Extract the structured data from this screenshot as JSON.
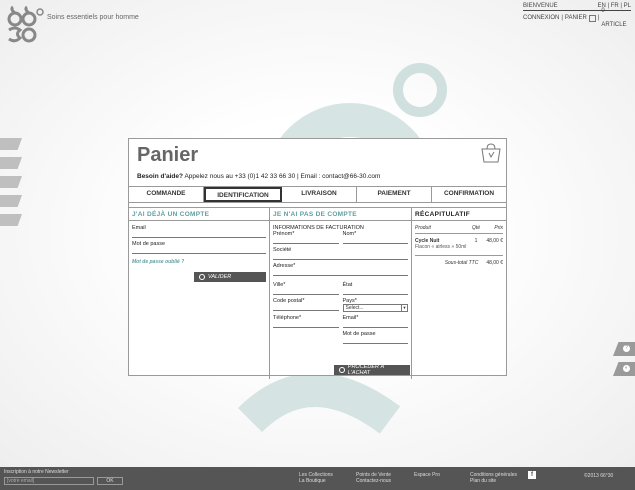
{
  "brand": {
    "tagline": "Soins essentiels pour homme"
  },
  "topbar": {
    "welcome": "BIENVENUE",
    "lang_en": "EN",
    "lang_fr": "FR",
    "lang_pl": "PL",
    "login": "CONNEXION",
    "cart_label": "PANIER",
    "cart_count": "0 ARTICLE"
  },
  "panel": {
    "title": "Panier",
    "help_bold": "Besoin d'aide?",
    "help_text": "Appelez nous au +33 (0)1 42 33 66 30 | Email : contact@66-30.com"
  },
  "steps": [
    "COMMANDE",
    "IDENTIFICATION",
    "LIVRAISON",
    "PAIEMENT",
    "CONFIRMATION"
  ],
  "active_step": "IDENTIFICATION",
  "account": {
    "heading": "J'AI DÉJÀ UN COMPTE",
    "email_label": "Email",
    "password_label": "Mot de passe",
    "forgot": "Mot de passe oublié ?",
    "submit": "VALIDER"
  },
  "new_account": {
    "heading": "JE N'AI PAS DE COMPTE",
    "subheading": "INFORMATIONS DE FACTURATION",
    "prenom": "Prénom*",
    "nom": "Nom*",
    "societe": "Société",
    "adresse": "Adresse*",
    "ville": "Ville*",
    "etat": "État",
    "code_postal": "Code postal*",
    "pays": "Pays*",
    "pays_value": "Select...",
    "telephone": "Téléphone*",
    "email": "Email*",
    "password": "Mot de passe",
    "submit": "PROCÉDER À L'ACHAT"
  },
  "summary": {
    "heading": "RÉCAPITULATIF",
    "col_product": "Produit",
    "col_qty": "Qté",
    "col_price": "Prix",
    "item_name": "Cycle Nuit",
    "item_desc": "Flacon « airless » 50ml",
    "item_qty": "1",
    "item_price": "48,00 €",
    "subtotal_label": "Sous-total TTC",
    "subtotal_value": "48,00 €"
  },
  "footer": {
    "newsletter_label": "Inscription à notre Newsletter",
    "newsletter_placeholder": "[votre email]",
    "newsletter_ok": "OK",
    "col1_a": "Les Collections",
    "col1_b": "La Boutique",
    "col2_a": "Points de Vente",
    "col2_b": "Contactez-nous",
    "col3_a": "Espace Pro",
    "col4_a": "Conditions générales",
    "col4_b": "Plan du site",
    "copyright": "©2013 66°30"
  },
  "colors": {
    "accent": "#5f9ea0",
    "dark_button": "#555555",
    "footer": "#555555"
  }
}
